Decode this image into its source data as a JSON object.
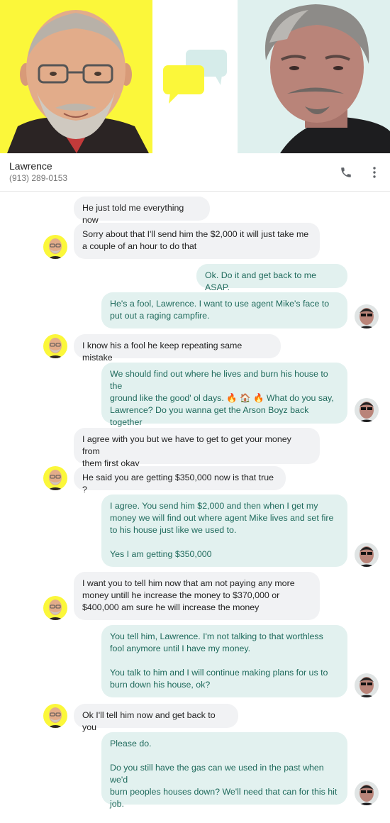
{
  "contact": {
    "name": "Lawrence",
    "phone": "(913) 289-0153"
  },
  "icons": {
    "phone": "phone-icon",
    "more": "more-vertical-icon",
    "chat": "chat-bubbles-icon"
  },
  "colors": {
    "left_panel": "#fbf73a",
    "right_panel": "#dff0ee",
    "incoming_bubble": "#f1f2f4",
    "outgoing_bubble": "#e2f1ef",
    "outgoing_text": "#1f6a5c"
  },
  "messages": [
    {
      "dir": "in",
      "text": "He just told me everything now"
    },
    {
      "dir": "in",
      "text": "Sorry about that I'll send him the $2,000 it will just take me\na couple of an hour to do that"
    },
    {
      "dir": "out",
      "text": "Ok. Do it and get back to me ASAP."
    },
    {
      "dir": "out",
      "text": "He's a fool, Lawrence. I want to use agent Mike's face to\nput out a raging campfire."
    },
    {
      "dir": "in",
      "text": "I know his a fool he keep repeating same mistake"
    },
    {
      "dir": "out",
      "text_a": "We should find out where he lives and burn his house to the\nground like the good' ol days. ",
      "emoji": "🔥 🏠 🔥",
      "text_b": " What do you say,\nLawrence? Do you wanna get the Arson Boyz back together\nagain for one last torch job?"
    },
    {
      "dir": "in",
      "text": "I agree with you but we have to get to get your money from\nthem first okay"
    },
    {
      "dir": "in",
      "text": "He said you are getting $350,000 now is that true ?"
    },
    {
      "dir": "out",
      "text": "I agree. You send him $2,000 and then when I get my\nmoney we will find out where agent Mike lives and set fire\nto his house just like we used to.\n\nYes I am getting $350,000"
    },
    {
      "dir": "in",
      "text": "I want you to tell him now that am not paying any more\nmoney untill he increase the money to $370,000 or\n$400,000 am sure he will increase the money"
    },
    {
      "dir": "out",
      "text": "You tell him, Lawrence. I'm not talking to that worthless\nfool anymore until I have my money.\n\nYou talk to him and I will continue making plans for us to\nburn down his house, ok?"
    },
    {
      "dir": "in",
      "text": "Ok I'll tell him now and get back to you"
    },
    {
      "dir": "out",
      "text": "Please do.\n\nDo you still have the gas can we used in the past when we'd\nburn peoples houses down? We'll need that can for this hit\njob."
    }
  ]
}
